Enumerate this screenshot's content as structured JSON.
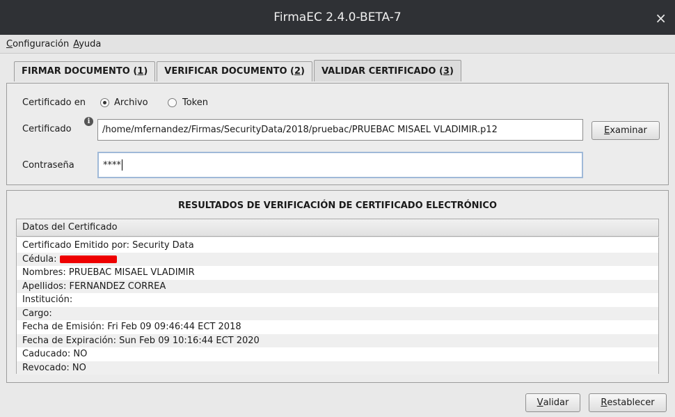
{
  "window": {
    "title": "FirmaEC 2.4.0-BETA-7"
  },
  "menu": {
    "config_mnemonic": "C",
    "config_rest": "onfiguración",
    "help_mnemonic": "A",
    "help_rest": "yuda"
  },
  "tabs": [
    {
      "label": "FIRMAR DOCUMENTO",
      "key": "1"
    },
    {
      "label": "VERIFICAR DOCUMENTO",
      "key": "2"
    },
    {
      "label": "VALIDAR CERTIFICADO",
      "key": "3"
    }
  ],
  "form": {
    "cert_in_label": "Certificado en",
    "radio_archivo": "Archivo",
    "radio_token": "Token",
    "selected": "Archivo",
    "cert_label": "Certificado",
    "cert_path": "/home/mfernandez/Firmas/SecurityData/2018/pruebac/PRUEBAC MISAEL VLADIMIR.p12",
    "browse_mnemonic": "E",
    "browse_rest": "xaminar",
    "password_label": "Contraseña",
    "password_value": "****"
  },
  "results": {
    "title": "RESULTADOS DE VERIFICACIÓN DE CERTIFICADO ELECTRÓNICO",
    "list_header": "Datos del Certificado",
    "rows": {
      "emitido": "Certificado Emitido por: Security Data",
      "cedula_label": "Cédula:",
      "nombres": "Nombres:  PRUEBAC MISAEL VLADIMIR",
      "apellidos": "Apellidos:  FERNANDEZ CORREA",
      "institucion": "Institución:",
      "cargo": "Cargo:",
      "emision": "Fecha de Emisión:  Fri Feb 09 09:46:44 ECT 2018",
      "expiracion": "Fecha de Expiración:  Sun Feb 09 10:16:44 ECT 2020",
      "caducado": "Caducado:  NO",
      "revocado": "Revocado: NO"
    }
  },
  "actions": {
    "validate_mnemonic": "V",
    "validate_rest": "alidar",
    "reset_mnemonic": "R",
    "reset_rest": "establecer"
  },
  "colors": {
    "titlebar": "#2f3135",
    "redaction": "#ee0000",
    "focus_border": "#9fb9d8"
  }
}
